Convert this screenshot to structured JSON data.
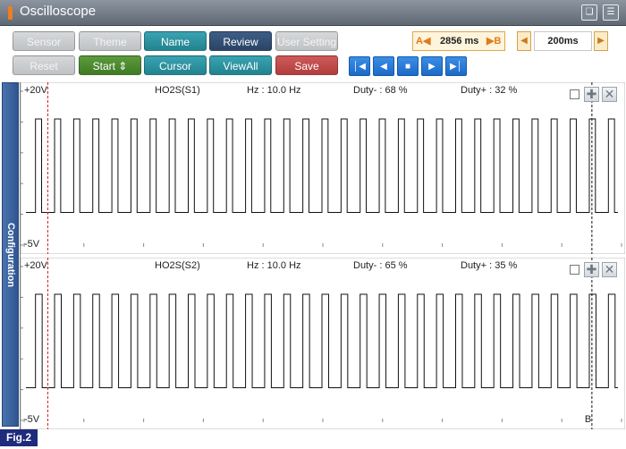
{
  "window": {
    "title": "Oscilloscope",
    "accent_color": "#ef7d22"
  },
  "toolbar": {
    "row1": [
      {
        "name": "sensor-button",
        "label": "Sensor",
        "style": "gray"
      },
      {
        "name": "theme-button",
        "label": "Theme",
        "style": "gray"
      },
      {
        "name": "name-button",
        "label": "Name",
        "style": "teal"
      },
      {
        "name": "review-button",
        "label": "Review",
        "style": "navy"
      },
      {
        "name": "user-setting-button",
        "label": "User Setting",
        "style": "gray"
      }
    ],
    "row2": [
      {
        "name": "reset-button",
        "label": "Reset",
        "style": "gray"
      },
      {
        "name": "start-button",
        "label": "Start ⇕",
        "style": "green"
      },
      {
        "name": "cursor-button",
        "label": "Cursor",
        "style": "teal"
      },
      {
        "name": "viewall-button",
        "label": "ViewAll",
        "style": "teal"
      },
      {
        "name": "save-button",
        "label": "Save",
        "style": "red"
      }
    ],
    "cursor_a_label": "A◀",
    "cursor_time": "2856 ms",
    "cursor_b_label": "▶B",
    "timebase": "200ms",
    "playback_icons": [
      "skip-start-icon",
      "step-back-icon",
      "stop-icon",
      "step-forward-icon",
      "skip-end-icon"
    ]
  },
  "side_tab": {
    "label": "Configuration"
  },
  "figure_label": "Fig.2",
  "chart_data": [
    {
      "type": "line",
      "title": "HO2S(S1)",
      "hz_text": "Hz : 10.0 Hz",
      "duty_minus_text": "Duty- : 68 %",
      "duty_plus_text": "Duty+ : 32 %",
      "ymax_label": "+20V",
      "ymin_label": "-5V",
      "ylim": [
        -5,
        20
      ],
      "frequency_hz": 10.0,
      "duty_plus": 0.32,
      "high_v": 15.5,
      "low_v": 0.3,
      "cycles": 31,
      "cursor_a_fraction": 0.037,
      "cursor_b_fraction": 0.956
    },
    {
      "type": "line",
      "title": "HO2S(S2)",
      "hz_text": "Hz : 10.0 Hz",
      "duty_minus_text": "Duty- : 65 %",
      "duty_plus_text": "Duty+ : 35 %",
      "ymax_label": "+20V",
      "ymin_label": "-5V",
      "cursor_b_label": "B",
      "ylim": [
        -5,
        20
      ],
      "frequency_hz": 10.0,
      "duty_plus": 0.35,
      "high_v": 15.5,
      "low_v": 0.3,
      "cycles": 31,
      "cursor_a_fraction": 0.037,
      "cursor_b_fraction": 0.956
    }
  ]
}
